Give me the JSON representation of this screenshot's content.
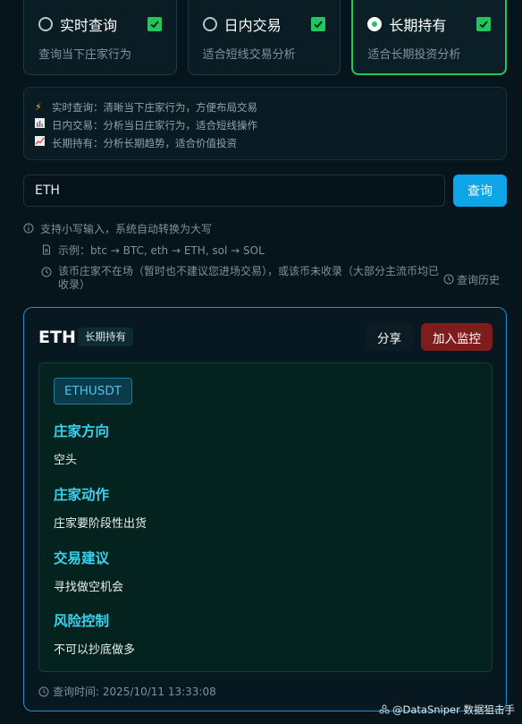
{
  "modes": [
    {
      "title": "实时查询",
      "desc": "查询当下庄家行为",
      "selected": false,
      "checked": true
    },
    {
      "title": "日内交易",
      "desc": "适合短线交易分析",
      "selected": false,
      "checked": true
    },
    {
      "title": "长期持有",
      "desc": "适合长期投资分析",
      "selected": true,
      "checked": true
    }
  ],
  "info": {
    "realtime": "实时查询：清晰当下庄家行为，方便布局交易",
    "intraday": "日内交易：分析当日庄家行为，适合短线操作",
    "longterm": "长期持有：分析长期趋势，适合价值投资"
  },
  "search": {
    "value": "ETH",
    "button": "查询"
  },
  "hints": {
    "lowercase": "支持小写输入，系统自动转换为大写",
    "example": "示例：btc → BTC, eth → ETH, sol → SOL",
    "warning": "该币庄家不在场（暂时也不建议您进场交易），或该币未收录（大部分主流币均已收录）",
    "history": "查询历史"
  },
  "result": {
    "symbol": "ETH",
    "mode_tag": "长期持有",
    "share": "分享",
    "monitor": "加入监控",
    "pair": "ETHUSDT",
    "sections": [
      {
        "title": "庄家方向",
        "body": "空头"
      },
      {
        "title": "庄家动作",
        "body": "庄家要阶段性出货"
      },
      {
        "title": "交易建议",
        "body": "寻找做空机会"
      },
      {
        "title": "风险控制",
        "body": "不可以抄底做多"
      }
    ],
    "query_time": "查询时间: 2025/10/11 13:33:08"
  },
  "watermark": "@DataSniper 数据狙击手",
  "colors": {
    "accent_green": "#22c55e",
    "accent_blue": "#0ea5e9",
    "danger": "#7f1d1d",
    "section_title": "#38d3ee"
  }
}
